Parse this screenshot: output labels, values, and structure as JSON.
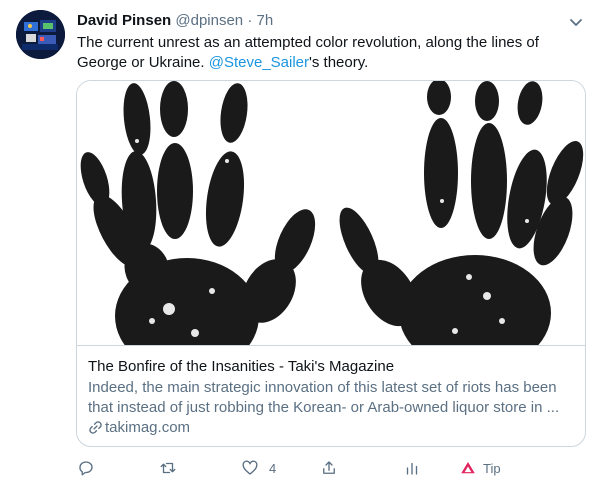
{
  "tweet": {
    "author_name": "David Pinsen",
    "author_handle": "@dpinsen",
    "separator": "·",
    "time": "7h",
    "text_before": "The current unrest as an attempted color revolution, along the lines of George or Ukraine. ",
    "mention": "@Steve_Sailer",
    "text_after": "'s theory."
  },
  "card": {
    "title": "The Bonfire of the Insanities - Taki's Magazine",
    "description": "Indeed, the main strategic innovation of this latest set of riots has been that instead of just robbing the Korean- or Arab-owned liquor store in ...",
    "domain": "takimag.com"
  },
  "actions": {
    "reply_icon": "reply-icon",
    "retweet_icon": "retweet-icon",
    "like_icon": "heart-icon",
    "like_count": "4",
    "share_icon": "share-icon",
    "analytics_icon": "analytics-icon",
    "tip_icon": "tip-icon",
    "tip_label": "Tip"
  },
  "colors": {
    "text_primary": "#0f1419",
    "text_secondary": "#5b7083",
    "link": "#1b95e0",
    "tip_accent": "#e0245e"
  }
}
